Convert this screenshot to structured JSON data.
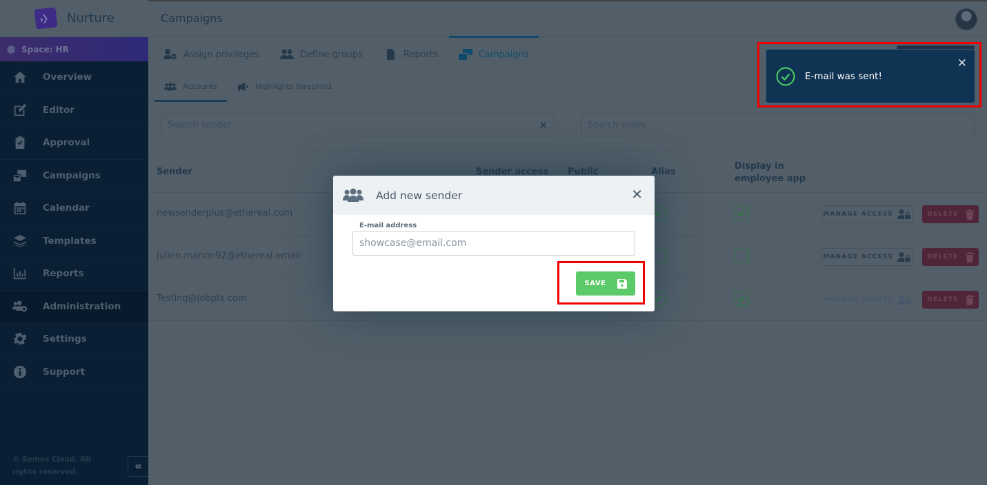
{
  "app": {
    "brand_name": "Nurture",
    "space_label": "Space: HR",
    "page_title": "Campaigns"
  },
  "sidebar": {
    "items": [
      {
        "label": "Overview",
        "icon": "home-icon"
      },
      {
        "label": "Editor",
        "icon": "edit-icon"
      },
      {
        "label": "Approval",
        "icon": "clipboard-check-icon"
      },
      {
        "label": "Campaigns",
        "icon": "campaigns-icon"
      },
      {
        "label": "Calendar",
        "icon": "calendar-icon"
      },
      {
        "label": "Templates",
        "icon": "layers-icon"
      },
      {
        "label": "Reports",
        "icon": "chart-icon"
      },
      {
        "label": "Administration",
        "icon": "users-cog-icon",
        "active": true
      },
      {
        "label": "Settings",
        "icon": "gear-icon"
      },
      {
        "label": "Support",
        "icon": "info-icon"
      }
    ],
    "footer": "© Semos Cloud. All rights reserved.",
    "collapse_label": "«"
  },
  "tabs": [
    {
      "label": "Assign privileges",
      "icon": "user-cog-icon"
    },
    {
      "label": "Define groups",
      "icon": "users-icon"
    },
    {
      "label": "Reports",
      "icon": "document-icon"
    },
    {
      "label": "Campaigns",
      "icon": "campaigns-icon",
      "active": true
    }
  ],
  "subtabs": [
    {
      "label": "Accounts",
      "icon": "users-group-icon",
      "active": true
    },
    {
      "label": "Highlights threshold",
      "icon": "megaphone-icon"
    }
  ],
  "search": {
    "sender_placeholder": "Search sender",
    "users_placeholder": "Search users",
    "clear_label": "✕"
  },
  "table": {
    "headers": [
      "Sender",
      "Sender access",
      "Public",
      "Alias",
      "Display in employee app"
    ],
    "rows": [
      {
        "email": "newsenderplus@ethereal.com",
        "alias": true,
        "display_in_app": true,
        "manage_enabled": true
      },
      {
        "email": "julien.marvin92@ethereal.email",
        "alias": false,
        "display_in_app": false,
        "manage_enabled": true
      },
      {
        "email": "Testing@jobpts.com",
        "alias": true,
        "display_in_app": true,
        "manage_enabled": false
      }
    ],
    "manage_label": "MANAGE ACCESS",
    "delete_label": "DELETE"
  },
  "modal": {
    "title": "Add new sender",
    "close_label": "✕",
    "field_label": "E-mail address",
    "field_value": "showcase@email.com",
    "save_label": "SAVE"
  },
  "toast": {
    "message": "E-mail was sent!",
    "close_label": "✕"
  },
  "colors": {
    "accent": "#0f4a6a",
    "save_green": "#5dca6a",
    "delete_red": "#4f2639",
    "toast_bg": "#0f3352",
    "highlight": "#f00000",
    "success": "#4cd164"
  }
}
